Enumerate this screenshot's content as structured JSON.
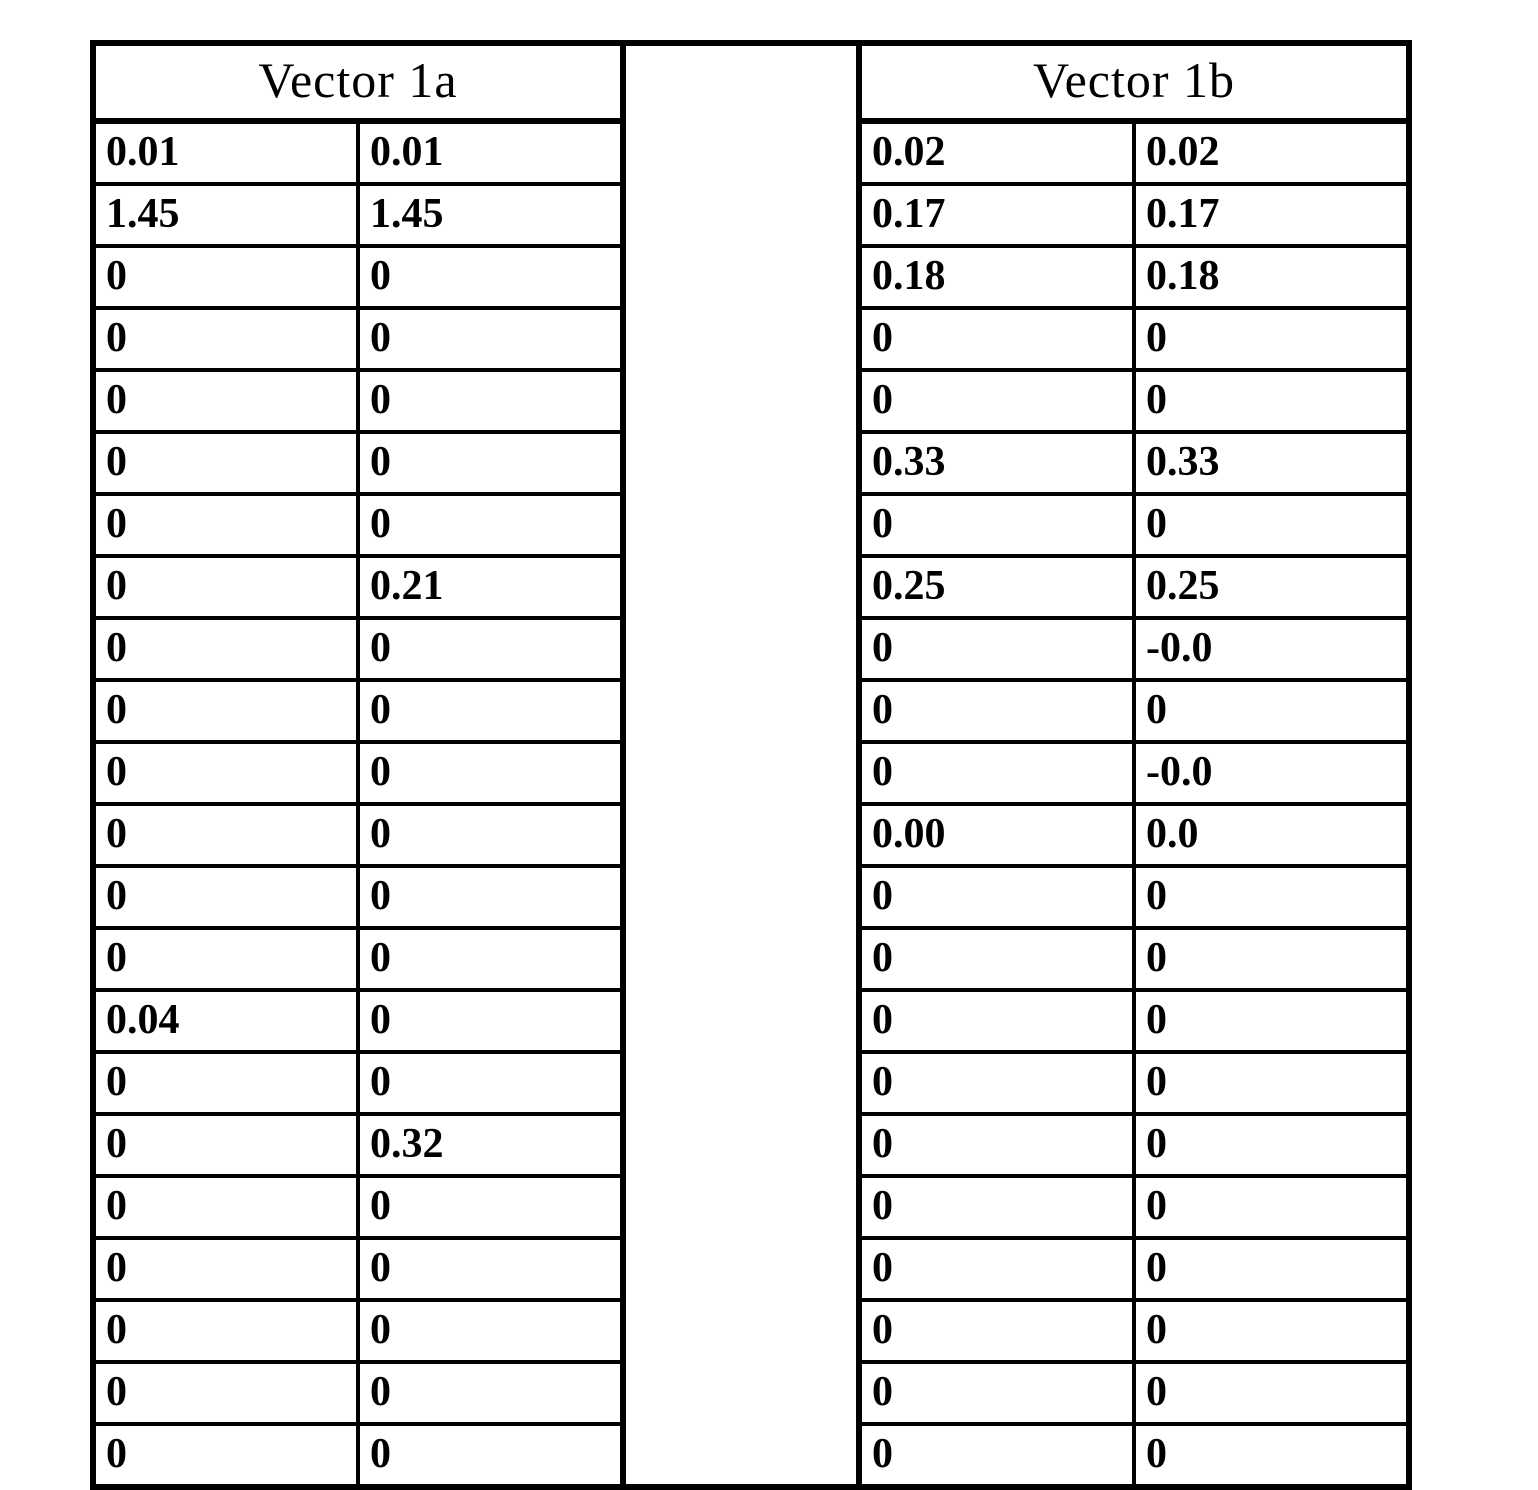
{
  "chart_data": {
    "type": "table",
    "tables": [
      {
        "name": "Vector 1a",
        "columns": 2,
        "rows": [
          [
            "0.01",
            "0.01"
          ],
          [
            "1.45",
            "1.45"
          ],
          [
            "0",
            "0"
          ],
          [
            "0",
            "0"
          ],
          [
            "0",
            "0"
          ],
          [
            "0",
            "0"
          ],
          [
            "0",
            "0"
          ],
          [
            "0",
            "0.21"
          ],
          [
            "0",
            "0"
          ],
          [
            "0",
            "0"
          ],
          [
            "0",
            "0"
          ],
          [
            "0",
            "0"
          ],
          [
            "0",
            "0"
          ],
          [
            "0",
            "0"
          ],
          [
            "0.04",
            "0"
          ],
          [
            "0",
            "0"
          ],
          [
            "0",
            "0.32"
          ],
          [
            "0",
            "0"
          ],
          [
            "0",
            "0"
          ],
          [
            "0",
            "0"
          ],
          [
            "0",
            "0"
          ],
          [
            "0",
            "0"
          ]
        ]
      },
      {
        "name": "Vector 1b",
        "columns": 2,
        "rows": [
          [
            "0.02",
            "0.02"
          ],
          [
            "0.17",
            "0.17"
          ],
          [
            "0.18",
            "0.18"
          ],
          [
            "0",
            "0"
          ],
          [
            "0",
            "0"
          ],
          [
            "0.33",
            "0.33"
          ],
          [
            "0",
            "0"
          ],
          [
            "0.25",
            "0.25"
          ],
          [
            "0",
            "-0.0"
          ],
          [
            "0",
            "0"
          ],
          [
            "0",
            "-0.0"
          ],
          [
            "0.00",
            "0.0"
          ],
          [
            "0",
            "0"
          ],
          [
            "0",
            "0"
          ],
          [
            "0",
            "0"
          ],
          [
            "0",
            "0"
          ],
          [
            "0",
            "0"
          ],
          [
            "0",
            "0"
          ],
          [
            "0",
            "0"
          ],
          [
            "0",
            "0"
          ],
          [
            "0",
            "0"
          ],
          [
            "0",
            "0"
          ]
        ]
      }
    ]
  },
  "headers": {
    "a": "Vector 1a",
    "b": "Vector 1b"
  },
  "table_a": {
    "r0": {
      "c0": "0.01",
      "c1": "0.01"
    },
    "r1": {
      "c0": "1.45",
      "c1": "1.45"
    },
    "r2": {
      "c0": "0",
      "c1": "0"
    },
    "r3": {
      "c0": "0",
      "c1": "0"
    },
    "r4": {
      "c0": "0",
      "c1": "0"
    },
    "r5": {
      "c0": "0",
      "c1": "0"
    },
    "r6": {
      "c0": "0",
      "c1": "0"
    },
    "r7": {
      "c0": "0",
      "c1": "0.21"
    },
    "r8": {
      "c0": "0",
      "c1": "0"
    },
    "r9": {
      "c0": "0",
      "c1": "0"
    },
    "r10": {
      "c0": "0",
      "c1": "0"
    },
    "r11": {
      "c0": "0",
      "c1": "0"
    },
    "r12": {
      "c0": "0",
      "c1": "0"
    },
    "r13": {
      "c0": "0",
      "c1": "0"
    },
    "r14": {
      "c0": "0.04",
      "c1": "0"
    },
    "r15": {
      "c0": "0",
      "c1": "0"
    },
    "r16": {
      "c0": "0",
      "c1": "0.32"
    },
    "r17": {
      "c0": "0",
      "c1": "0"
    },
    "r18": {
      "c0": "0",
      "c1": "0"
    },
    "r19": {
      "c0": "0",
      "c1": "0"
    },
    "r20": {
      "c0": "0",
      "c1": "0"
    },
    "r21": {
      "c0": "0",
      "c1": "0"
    }
  },
  "table_b": {
    "r0": {
      "c0": "0.02",
      "c1": "0.02"
    },
    "r1": {
      "c0": "0.17",
      "c1": "0.17"
    },
    "r2": {
      "c0": "0.18",
      "c1": "0.18"
    },
    "r3": {
      "c0": "0",
      "c1": "0"
    },
    "r4": {
      "c0": "0",
      "c1": "0"
    },
    "r5": {
      "c0": "0.33",
      "c1": "0.33"
    },
    "r6": {
      "c0": "0",
      "c1": "0"
    },
    "r7": {
      "c0": "0.25",
      "c1": "0.25"
    },
    "r8": {
      "c0": "0",
      "c1": "-0.0"
    },
    "r9": {
      "c0": "0",
      "c1": "0"
    },
    "r10": {
      "c0": "0",
      "c1": "-0.0"
    },
    "r11": {
      "c0": "0.00",
      "c1": "0.0"
    },
    "r12": {
      "c0": "0",
      "c1": "0"
    },
    "r13": {
      "c0": "0",
      "c1": "0"
    },
    "r14": {
      "c0": "0",
      "c1": "0"
    },
    "r15": {
      "c0": "0",
      "c1": "0"
    },
    "r16": {
      "c0": "0",
      "c1": "0"
    },
    "r17": {
      "c0": "0",
      "c1": "0"
    },
    "r18": {
      "c0": "0",
      "c1": "0"
    },
    "r19": {
      "c0": "0",
      "c1": "0"
    },
    "r20": {
      "c0": "0",
      "c1": "0"
    },
    "r21": {
      "c0": "0",
      "c1": "0"
    }
  }
}
